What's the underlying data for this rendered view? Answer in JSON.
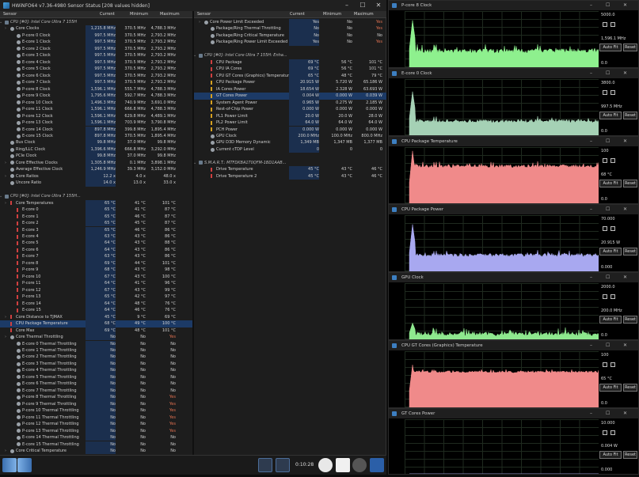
{
  "window": {
    "title": "HWiNFO64 v7.36-4980 Sensor Status [208 values hidden]",
    "minimize": "–",
    "maximize": "☐",
    "close": "✕"
  },
  "columns": {
    "sensor": "Sensor",
    "current": "Current",
    "minimum": "Minimum",
    "maximum": "Maximum"
  },
  "left_rows": [
    {
      "t": "hdr",
      "label": "CPU [#0]: Intel Core Ultra 7 155H"
    },
    {
      "t": "grp",
      "label": "Core Clocks",
      "cur": "1,215.8 MHz",
      "min": "370.5 MHz",
      "max": "4,788.3 MHz"
    },
    {
      "label": "P-core 0 Clock",
      "cur": "997.5 MHz",
      "min": "370.5 MHz",
      "max": "2,793.2 MHz",
      "i": "c"
    },
    {
      "label": "E-core 1 Clock",
      "cur": "997.5 MHz",
      "min": "370.5 MHz",
      "max": "2,793.2 MHz",
      "i": "c"
    },
    {
      "label": "E-core 2 Clock",
      "cur": "997.5 MHz",
      "min": "370.5 MHz",
      "max": "2,793.2 MHz",
      "i": "c"
    },
    {
      "label": "E-core 3 Clock",
      "cur": "997.5 MHz",
      "min": "370.5 MHz",
      "max": "2,793.2 MHz",
      "i": "c"
    },
    {
      "label": "E-core 4 Clock",
      "cur": "997.5 MHz",
      "min": "370.5 MHz",
      "max": "2,793.2 MHz",
      "i": "c"
    },
    {
      "label": "E-core 5 Clock",
      "cur": "997.5 MHz",
      "min": "370.5 MHz",
      "max": "2,793.2 MHz",
      "i": "c"
    },
    {
      "label": "E-core 6 Clock",
      "cur": "997.5 MHz",
      "min": "370.5 MHz",
      "max": "2,793.2 MHz",
      "i": "c"
    },
    {
      "label": "E-core 7 Clock",
      "cur": "997.5 MHz",
      "min": "370.5 MHz",
      "max": "2,793.2 MHz",
      "i": "c"
    },
    {
      "label": "P-core 8 Clock",
      "cur": "1,596.1 MHz",
      "min": "555.7 MHz",
      "max": "4,788.3 MHz",
      "i": "c"
    },
    {
      "label": "P-core 9 Clock",
      "cur": "1,795.6 MHz",
      "min": "592.7 MHz",
      "max": "4,788.3 MHz",
      "i": "c"
    },
    {
      "label": "P-core 10 Clock",
      "cur": "1,496.3 MHz",
      "min": "740.9 MHz",
      "max": "3,691.0 MHz",
      "i": "c"
    },
    {
      "label": "P-core 11 Clock",
      "cur": "1,596.1 MHz",
      "min": "666.8 MHz",
      "max": "4,788.3 MHz",
      "i": "c"
    },
    {
      "label": "P-core 12 Clock",
      "cur": "1,596.1 MHz",
      "min": "629.8 MHz",
      "max": "4,489.1 MHz",
      "i": "c"
    },
    {
      "label": "P-core 13 Clock",
      "cur": "1,596.1 MHz",
      "min": "703.9 MHz",
      "max": "3,790.8 MHz",
      "i": "c"
    },
    {
      "label": "E-core 14 Clock",
      "cur": "897.8 MHz",
      "min": "399.8 MHz",
      "max": "1,895.4 MHz",
      "i": "c"
    },
    {
      "label": "E-core 15 Clock",
      "cur": "897.8 MHz",
      "min": "370.5 MHz",
      "max": "1,895.4 MHz",
      "i": "c"
    },
    {
      "label": "Bus Clock",
      "cur": "99.8 MHz",
      "min": "37.0 MHz",
      "max": "99.8 MHz",
      "i": "c",
      "lv": 1
    },
    {
      "label": "Ring/LLC Clock",
      "cur": "1,396.6 MHz",
      "min": "666.8 MHz",
      "max": "3,292.0 MHz",
      "i": "c",
      "lv": 1
    },
    {
      "label": "PCIe Clock",
      "cur": "99.8 MHz",
      "min": "37.0 MHz",
      "max": "99.8 MHz",
      "i": "c",
      "lv": 1
    },
    {
      "t": "grp",
      "label": "Core Effective Clocks",
      "cur": "1,305.8 MHz",
      "min": "0.1 MHz",
      "max": "3,898.1 MHz"
    },
    {
      "label": "Average Effective Clock",
      "cur": "1,246.9 MHz",
      "min": "39.3 MHz",
      "max": "3,152.0 MHz",
      "i": "c",
      "lv": 1
    },
    {
      "t": "grp",
      "label": "Core Ratios",
      "cur": "12.2 x",
      "min": "4.0 x",
      "max": "48.0 x"
    },
    {
      "label": "Uncore Ratio",
      "cur": "14.0 x",
      "min": "13.0 x",
      "max": "33.0 x",
      "i": "c",
      "lv": 1
    },
    {
      "t": "blank"
    },
    {
      "t": "hdr",
      "label": "CPU [#0]: Intel Core Ultra 7 155H..."
    },
    {
      "t": "grp",
      "label": "Core Temperatures",
      "cur": "65 °C",
      "min": "41 °C",
      "max": "101 °C",
      "i": "t"
    },
    {
      "label": "E-core 0",
      "cur": "65 °C",
      "min": "41 °C",
      "max": "87 °C",
      "i": "t"
    },
    {
      "label": "E-core 1",
      "cur": "65 °C",
      "min": "46 °C",
      "max": "87 °C",
      "i": "t"
    },
    {
      "label": "E-core 2",
      "cur": "65 °C",
      "min": "45 °C",
      "max": "87 °C",
      "i": "t"
    },
    {
      "label": "E-core 3",
      "cur": "65 °C",
      "min": "46 °C",
      "max": "86 °C",
      "i": "t"
    },
    {
      "label": "E-core 4",
      "cur": "63 °C",
      "min": "43 °C",
      "max": "86 °C",
      "i": "t"
    },
    {
      "label": "E-core 5",
      "cur": "64 °C",
      "min": "43 °C",
      "max": "88 °C",
      "i": "t"
    },
    {
      "label": "E-core 6",
      "cur": "64 °C",
      "min": "43 °C",
      "max": "86 °C",
      "i": "t"
    },
    {
      "label": "E-core 7",
      "cur": "63 °C",
      "min": "43 °C",
      "max": "86 °C",
      "i": "t"
    },
    {
      "label": "P-core 8",
      "cur": "69 °C",
      "min": "44 °C",
      "max": "101 °C",
      "i": "t"
    },
    {
      "label": "P-core 9",
      "cur": "68 °C",
      "min": "43 °C",
      "max": "98 °C",
      "i": "t"
    },
    {
      "label": "P-core 10",
      "cur": "67 °C",
      "min": "43 °C",
      "max": "100 °C",
      "i": "t"
    },
    {
      "label": "P-core 11",
      "cur": "64 °C",
      "min": "41 °C",
      "max": "96 °C",
      "i": "t"
    },
    {
      "label": "P-core 12",
      "cur": "67 °C",
      "min": "43 °C",
      "max": "99 °C",
      "i": "t"
    },
    {
      "label": "P-core 13",
      "cur": "65 °C",
      "min": "42 °C",
      "max": "97 °C",
      "i": "t"
    },
    {
      "label": "E-core 14",
      "cur": "64 °C",
      "min": "48 °C",
      "max": "76 °C",
      "i": "t"
    },
    {
      "label": "E-core 15",
      "cur": "64 °C",
      "min": "46 °C",
      "max": "76 °C",
      "i": "t"
    },
    {
      "t": "grp",
      "label": "Core Distance to TjMAX",
      "cur": "45 °C",
      "min": "9 °C",
      "max": "69 °C",
      "i": "t"
    },
    {
      "label": "CPU Package Temperature",
      "cur": "68 °C",
      "min": "49 °C",
      "max": "100 °C",
      "i": "t",
      "lv": 1,
      "sel": true
    },
    {
      "label": "Core Max",
      "cur": "69 °C",
      "min": "48 °C",
      "max": "101 °C",
      "i": "t",
      "lv": 1
    },
    {
      "t": "grp",
      "label": "Core Thermal Throttling",
      "cur": "No",
      "min": "No",
      "max": "Yes",
      "i": "o"
    },
    {
      "label": "E-core 0 Thermal Throttling",
      "cur": "No",
      "min": "No",
      "max": "No",
      "i": "o"
    },
    {
      "label": "E-core 1 Thermal Throttling",
      "cur": "No",
      "min": "No",
      "max": "No",
      "i": "o"
    },
    {
      "label": "E-core 2 Thermal Throttling",
      "cur": "No",
      "min": "No",
      "max": "No",
      "i": "o"
    },
    {
      "label": "E-core 3 Thermal Throttling",
      "cur": "No",
      "min": "No",
      "max": "No",
      "i": "o"
    },
    {
      "label": "E-core 4 Thermal Throttling",
      "cur": "No",
      "min": "No",
      "max": "No",
      "i": "o"
    },
    {
      "label": "E-core 5 Thermal Throttling",
      "cur": "No",
      "min": "No",
      "max": "No",
      "i": "o"
    },
    {
      "label": "E-core 6 Thermal Throttling",
      "cur": "No",
      "min": "No",
      "max": "No",
      "i": "o"
    },
    {
      "label": "E-core 7 Thermal Throttling",
      "cur": "No",
      "min": "No",
      "max": "No",
      "i": "o"
    },
    {
      "label": "P-core 8 Thermal Throttling",
      "cur": "No",
      "min": "No",
      "max": "Yes",
      "i": "o"
    },
    {
      "label": "P-core 9 Thermal Throttling",
      "cur": "No",
      "min": "No",
      "max": "Yes",
      "i": "o"
    },
    {
      "label": "P-core 10 Thermal Throttling",
      "cur": "No",
      "min": "No",
      "max": "Yes",
      "i": "o"
    },
    {
      "label": "P-core 11 Thermal Throttling",
      "cur": "No",
      "min": "No",
      "max": "Yes",
      "i": "o"
    },
    {
      "label": "P-core 12 Thermal Throttling",
      "cur": "No",
      "min": "No",
      "max": "Yes",
      "i": "o"
    },
    {
      "label": "P-core 13 Thermal Throttling",
      "cur": "No",
      "min": "No",
      "max": "Yes",
      "i": "o"
    },
    {
      "label": "E-core 14 Thermal Throttling",
      "cur": "No",
      "min": "No",
      "max": "No",
      "i": "o"
    },
    {
      "label": "E-core 15 Thermal Throttling",
      "cur": "No",
      "min": "No",
      "max": "No",
      "i": "o"
    },
    {
      "t": "grp",
      "label": "Core Critical Temperature",
      "cur": "No",
      "min": "No",
      "max": "No",
      "i": "o"
    }
  ],
  "right_rows": [
    {
      "t": "grp",
      "label": "Core Power Limit Exceeded",
      "cur": "Yes",
      "min": "No",
      "max": "Yes",
      "i": "o"
    },
    {
      "label": "Package/Ring Thermal Throttling",
      "cur": "No",
      "min": "No",
      "max": "Yes",
      "i": "o"
    },
    {
      "label": "Package/Ring Critical Temperature",
      "cur": "No",
      "min": "No",
      "max": "No",
      "i": "o"
    },
    {
      "label": "Package/Ring Power Limit Exceeded",
      "cur": "Yes",
      "min": "No",
      "max": "Yes",
      "i": "o"
    },
    {
      "t": "blank"
    },
    {
      "t": "hdr",
      "label": "CPU [#0]: Intel Core Ultra 7 155H: Enha..."
    },
    {
      "label": "CPU Package",
      "cur": "69 °C",
      "min": "56 °C",
      "max": "101 °C",
      "i": "t"
    },
    {
      "label": "CPU IA Cores",
      "cur": "69 °C",
      "min": "56 °C",
      "max": "101 °C",
      "i": "t"
    },
    {
      "label": "CPU GT Cores (Graphics) Temperature",
      "cur": "65 °C",
      "min": "48 °C",
      "max": "79 °C",
      "i": "t"
    },
    {
      "label": "CPU Package Power",
      "cur": "20.915 W",
      "min": "5.720 W",
      "max": "65.186 W",
      "i": "p"
    },
    {
      "label": "IA Cores Power",
      "cur": "18.654 W",
      "min": "2.328 W",
      "max": "63.693 W",
      "i": "p"
    },
    {
      "label": "GT Cores Power",
      "cur": "0.004 W",
      "min": "0.000 W",
      "max": "0.039 W",
      "i": "p",
      "sel": true
    },
    {
      "label": "System Agent Power",
      "cur": "0.965 W",
      "min": "0.275 W",
      "max": "2.185 W",
      "i": "p"
    },
    {
      "label": "Rest-of-Chip Power",
      "cur": "0.000 W",
      "min": "0.000 W",
      "max": "0.000 W",
      "i": "p"
    },
    {
      "label": "PL1 Power Limit",
      "cur": "20.0 W",
      "min": "20.0 W",
      "max": "28.0 W",
      "i": "p"
    },
    {
      "label": "PL2 Power Limit",
      "cur": "64.0 W",
      "min": "64.0 W",
      "max": "64.0 W",
      "i": "p"
    },
    {
      "label": "PCH Power",
      "cur": "0.000 W",
      "min": "0.000 W",
      "max": "0.000 W",
      "i": "p"
    },
    {
      "label": "GPU Clock",
      "cur": "200.0 MHz",
      "min": "100.0 MHz",
      "max": "800.0 MHz",
      "i": "c"
    },
    {
      "label": "GPU D3D Memory Dynamic",
      "cur": "1,349 MB",
      "min": "1,347 MB",
      "max": "1,377 MB",
      "i": "c"
    },
    {
      "label": "Current cTDP Level",
      "cur": "0",
      "min": "0",
      "max": "0",
      "i": "c"
    },
    {
      "t": "blank"
    },
    {
      "t": "hdr",
      "label": "S.M.A.R.T.: MTFDKBA1T0QFM-1BD1AAB..."
    },
    {
      "label": "Drive Temperature",
      "cur": "45 °C",
      "min": "43 °C",
      "max": "46 °C",
      "i": "t"
    },
    {
      "label": "Drive Temperature 2",
      "cur": "45 °C",
      "min": "43 °C",
      "max": "46 °C",
      "i": "t"
    }
  ],
  "statusbar": {
    "timer": "0:10:28"
  },
  "graph_buttons": {
    "auto_fit": "Auto Fit",
    "reset": "Reset"
  },
  "graphs": [
    {
      "title": "P-core 8 Clock",
      "max": "5000.0",
      "cur": "1,596.1 MHz",
      "min": "0.0",
      "color": "#8ef08e",
      "spike": 0.86,
      "level": 0.3,
      "noise": 0.04
    },
    {
      "title": "E-core 0 Clock",
      "max": "3800.0",
      "cur": "997.5 MHz",
      "min": "0.0",
      "color": "#a5d1b5",
      "spike": 0.8,
      "level": 0.26,
      "noise": 0.03
    },
    {
      "title": "CPU Package Temperature",
      "max": "100",
      "cur": "68 °C",
      "min": "0.0",
      "color": "#f08a8a",
      "spike": 0.96,
      "level": 0.68,
      "noise": 0.03
    },
    {
      "title": "CPU Package Power",
      "max": "70.000",
      "cur": "20.915 W",
      "min": "0.000",
      "color": "#a8a8f0",
      "spike": 0.86,
      "level": 0.3,
      "noise": 0.03
    },
    {
      "title": "GPU Clock",
      "max": "2000.0",
      "cur": "200.0 MHz",
      "min": "0.0",
      "color": "#8ee88e",
      "spike": 0.3,
      "level": 0.1,
      "noise": 0.04
    },
    {
      "title": "CPU GT Cores (Graphics) Temperature",
      "max": "100",
      "cur": "65 °C",
      "min": "0.0",
      "color": "#f08a8a",
      "spike": 0.78,
      "level": 0.65,
      "noise": 0.02
    },
    {
      "title": "GT Cores Power",
      "max": "10.000",
      "cur": "0.004 W",
      "min": "0.000",
      "color": "#a8a8f0",
      "spike": 0.0,
      "level": 0.0,
      "noise": 0.0
    }
  ]
}
